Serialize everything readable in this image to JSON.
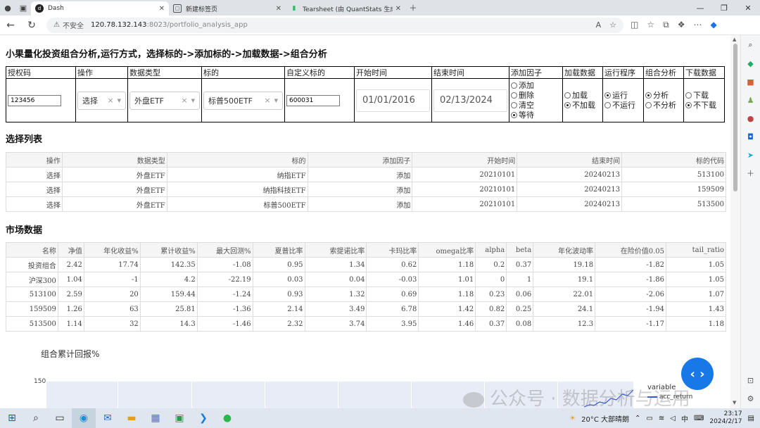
{
  "browser": {
    "tabs": [
      {
        "title": "Dash",
        "active": true
      },
      {
        "title": "新建标签页",
        "active": false
      },
      {
        "title": "Tearsheet (由 QuantStats 生成)",
        "active": false
      }
    ],
    "security_label": "不安全",
    "url_host": "120.78.132.143",
    "url_path": ":8023/portfolio_analysis_app"
  },
  "page": {
    "title": "小果量化投资组合分析,运行方式，选择标的->添加标的->加载数据->组合分析",
    "controls": {
      "headers": [
        "授权码",
        "操作",
        "数据类型",
        "标的",
        "自定义标的",
        "开始时间",
        "结束时间",
        "添加因子",
        "加载数据",
        "运行程序",
        "组合分析",
        "下载数据"
      ],
      "auth_code": "123456",
      "operation": "选择",
      "data_type": "外盘ETF",
      "symbol": "标普500ETF",
      "custom_symbol": "600031",
      "start_date": "01/01/2016",
      "end_date": "02/13/2024",
      "factor_options": [
        {
          "label": "添加",
          "checked": false
        },
        {
          "label": "删除",
          "checked": false
        },
        {
          "label": "清空",
          "checked": false
        },
        {
          "label": "等待",
          "checked": true
        }
      ],
      "load_options": [
        {
          "label": "加载",
          "checked": false
        },
        {
          "label": "不加载",
          "checked": true
        }
      ],
      "run_options": [
        {
          "label": "运行",
          "checked": true
        },
        {
          "label": "不运行",
          "checked": false
        }
      ],
      "analysis_options": [
        {
          "label": "分析",
          "checked": true
        },
        {
          "label": "不分析",
          "checked": false
        }
      ],
      "download_options": [
        {
          "label": "下载",
          "checked": false
        },
        {
          "label": "不下载",
          "checked": true
        }
      ]
    },
    "selection_list": {
      "title": "选择列表",
      "columns": [
        "操作",
        "数据类型",
        "标的",
        "添加因子",
        "开始时间",
        "结束时间",
        "标的代码"
      ],
      "rows": [
        [
          "选择",
          "外盘ETF",
          "纳指ETF",
          "添加",
          "20210101",
          "20240213",
          "513100"
        ],
        [
          "选择",
          "外盘ETF",
          "纳指科技ETF",
          "添加",
          "20210101",
          "20240213",
          "159509"
        ],
        [
          "选择",
          "外盘ETF",
          "标普500ETF",
          "添加",
          "20210101",
          "20240213",
          "513500"
        ]
      ]
    },
    "market_data": {
      "title": "市场数据",
      "columns": [
        "名称",
        "净值",
        "年化收益%",
        "累计收益%",
        "最大回测%",
        "夏普比率",
        "索提诺比率",
        "卡玛比率",
        "omega比率",
        "alpha",
        "beta",
        "年化波动率",
        "在险价值0.05",
        "tail_ratio"
      ],
      "rows": [
        [
          "投资组合",
          "2.42",
          "17.74",
          "142.35",
          "-1.08",
          "0.95",
          "1.34",
          "0.62",
          "1.18",
          "0.2",
          "0.37",
          "19.18",
          "-1.82",
          "1.05"
        ],
        [
          "沪深300",
          "1.04",
          "-1",
          "4.2",
          "-22.19",
          "0.03",
          "0.04",
          "-0.03",
          "1.01",
          "0",
          "1",
          "19.1",
          "-1.86",
          "1.05"
        ],
        [
          "513100",
          "2.59",
          "20",
          "159.44",
          "-1.24",
          "0.93",
          "1.32",
          "0.69",
          "1.18",
          "0.23",
          "0.06",
          "22.01",
          "-2.06",
          "1.07"
        ],
        [
          "159509",
          "1.26",
          "63",
          "25.81",
          "-1.36",
          "2.14",
          "3.49",
          "6.78",
          "1.42",
          "0.82",
          "0.25",
          "24.1",
          "-1.94",
          "1.43"
        ],
        [
          "513500",
          "1.14",
          "32",
          "14.3",
          "-1.46",
          "2.32",
          "3.74",
          "3.95",
          "1.46",
          "0.37",
          "0.08",
          "12.3",
          "-1.17",
          "1.18"
        ]
      ]
    },
    "chart": {
      "title": "组合累计回报%",
      "ytick_top": "150",
      "legend_title": "variable",
      "legend_item": "acc_return"
    },
    "watermark": "公众号 · 数据分析与运用"
  },
  "taskbar": {
    "weather": "20°C 大部晴朗",
    "ime": "中",
    "time": "23:17",
    "date": "2024/2/17"
  }
}
